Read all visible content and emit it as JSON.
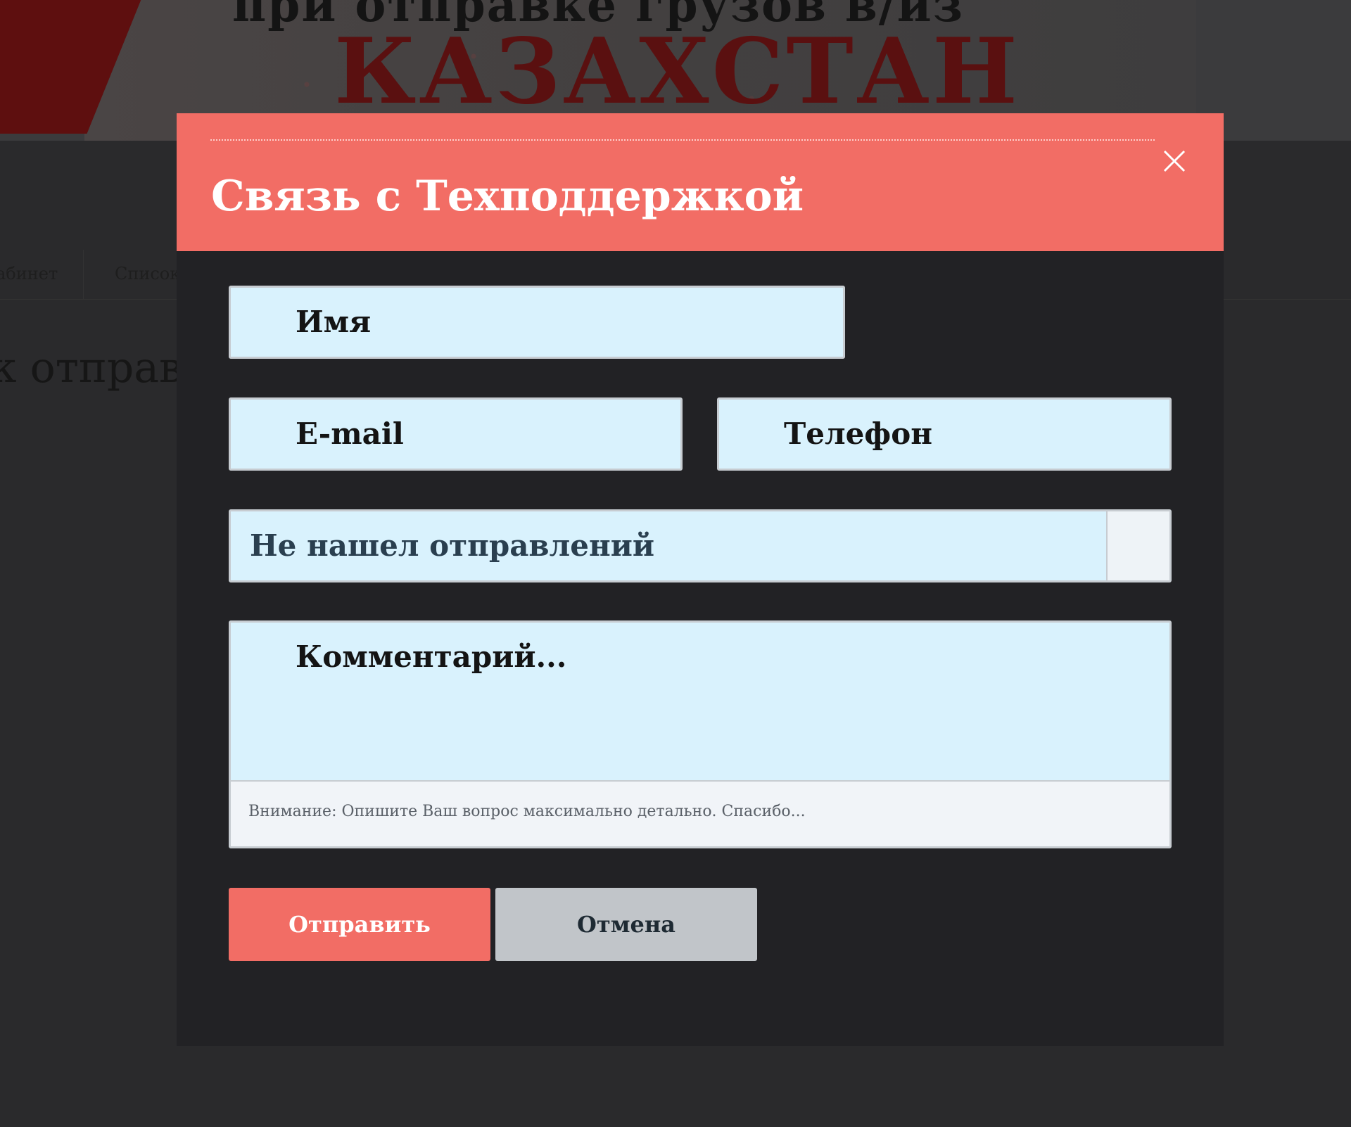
{
  "background": {
    "banner_line1": "при отправке грузов в/из",
    "banner_line2": "КАЗАХСТАН",
    "nav_items": [
      "абинет",
      "Список"
    ],
    "heading": "к отправл"
  },
  "modal": {
    "title": "Связь с Техподдержкой",
    "close_icon": "close-icon",
    "fields": {
      "name_placeholder": "Имя",
      "email_placeholder": "E-mail",
      "phone_placeholder": "Телефон",
      "topic_selected": "Не нашел отправлений",
      "comment_placeholder": "Комментарий...",
      "comment_hint": "Внимание: Опишите Ваш вопрос максимально детально. Спасибо..."
    },
    "buttons": {
      "submit": "Отправить",
      "cancel": "Отмена"
    }
  },
  "colors": {
    "accent": "#f26d65",
    "modal_bg": "#222225",
    "field_bg": "#d9f2fd",
    "cancel_bg": "#c1c5c9"
  }
}
